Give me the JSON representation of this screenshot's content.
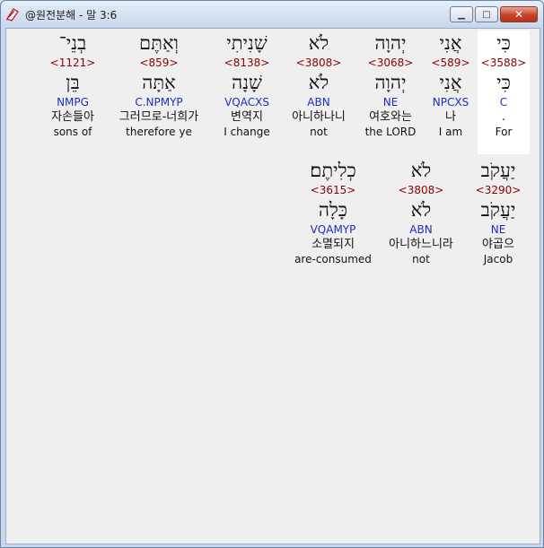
{
  "window": {
    "title": "@원전분해 - 말 3:6",
    "minimize_glyph": "▁",
    "maximize_glyph": "□",
    "close_glyph": "✕",
    "icon": "pen-book-icon"
  },
  "rows": [
    {
      "words": [
        {
          "hebrew": "כִּי",
          "strong": "<3588>",
          "lemma": "כִּי",
          "parsing": "C",
          "korean": ".",
          "english": "For",
          "highlight": true
        },
        {
          "hebrew": "אֲנִי",
          "strong": "<589>",
          "lemma": "אֲנִי",
          "parsing": "NPCXS",
          "korean": "나",
          "english": "I am",
          "highlight": false
        },
        {
          "hebrew": "יְהוָה",
          "strong": "<3068>",
          "lemma": "יְהוָה",
          "parsing": "NE",
          "korean": "여호와는",
          "english": "the LORD",
          "highlight": false
        },
        {
          "hebrew": "לֹא",
          "strong": "<3808>",
          "lemma": "לֹא",
          "parsing": "ABN",
          "korean": "아니하나니",
          "english": "not",
          "highlight": false
        },
        {
          "hebrew": "שָׁנִיתִי",
          "strong": "<8138>",
          "lemma": "שָׁנָה",
          "parsing": "VQACXS",
          "korean": "변역지",
          "english": "I change",
          "highlight": false
        },
        {
          "hebrew": "וְאַתֶּם",
          "strong": "<859>",
          "lemma": "אַתָּה",
          "parsing": "C.NPMYP",
          "korean": "그러므로-너희가",
          "english": "therefore ye",
          "highlight": false
        },
        {
          "hebrew": "בְנֵי־",
          "strong": "<1121>",
          "lemma": "בֵּן",
          "parsing": "NMPG",
          "korean": "자손들아",
          "english": "sons of",
          "highlight": false
        }
      ]
    },
    {
      "words": [
        {
          "hebrew": "יַעֲקֹב",
          "strong": "<3290>",
          "lemma": "יַעֲקֹב",
          "parsing": "NE",
          "korean": "야곱으",
          "english": "Jacob",
          "highlight": false
        },
        {
          "hebrew": "לֹא",
          "strong": "<3808>",
          "lemma": "לֹא",
          "parsing": "ABN",
          "korean": "아니하느니라",
          "english": "not",
          "highlight": false
        },
        {
          "hebrew": "כְלִיתֶם׃",
          "strong": "<3615>",
          "lemma": "כָּלָה",
          "parsing": "VQAMYP",
          "korean": "소멸되지",
          "english": "are-consumed",
          "highlight": false
        }
      ]
    }
  ]
}
